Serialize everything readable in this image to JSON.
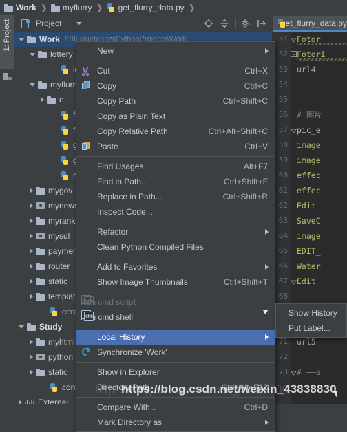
{
  "breadcrumb": {
    "items": [
      {
        "label": "Work",
        "icon": "folder-icon",
        "bold": true
      },
      {
        "label": "myflurry",
        "icon": "folder-icon",
        "bold": false
      },
      {
        "label": "get_flurry_data.py",
        "icon": "python-file-icon",
        "bold": false
      }
    ],
    "separator": "❯"
  },
  "left_tool_tab": {
    "label": "1: Project"
  },
  "project_toolbar": {
    "title": "Project",
    "icons": [
      {
        "name": "locate-icon"
      },
      {
        "name": "expand-collapse-icon"
      },
      {
        "name": "settings-gear-icon"
      },
      {
        "name": "hide-panel-icon"
      }
    ]
  },
  "editor_tabs": [
    {
      "label": "get_flurry_data.py",
      "icon": "python-file-icon",
      "active": true
    }
  ],
  "tree": {
    "root_path": "E:\\liuxuefengzi\\PythonProjects\\Work",
    "items": [
      {
        "label": "Work",
        "depth": 0,
        "twisty": "down",
        "icon": "folder-icon",
        "bold": true,
        "selected": true,
        "path": "E:\\liuxuefengzi\\PythonProjects\\Work"
      },
      {
        "label": "lottery",
        "depth": 1,
        "twisty": "down",
        "icon": "folder-icon",
        "bold": false,
        "selected": false
      },
      {
        "label": "lo",
        "depth": 3,
        "twisty": "none",
        "icon": "python-file-icon",
        "bold": false,
        "selected": false
      },
      {
        "label": "myflurry",
        "depth": 1,
        "twisty": "down",
        "icon": "folder-icon",
        "bold": false,
        "selected": false
      },
      {
        "label": "e",
        "depth": 2,
        "twisty": "right",
        "icon": "folder-icon",
        "bold": false,
        "selected": false
      },
      {
        "label": "f",
        "depth": 3,
        "twisty": "none",
        "icon": "python-file-icon",
        "bold": false,
        "selected": false
      },
      {
        "label": "f",
        "depth": 3,
        "twisty": "none",
        "icon": "python-file-icon",
        "bold": false,
        "selected": false
      },
      {
        "label": "g",
        "depth": 3,
        "twisty": "none",
        "icon": "python-file-icon",
        "bold": false,
        "selected": false
      },
      {
        "label": "g",
        "depth": 3,
        "twisty": "none",
        "icon": "python-file-icon",
        "bold": false,
        "selected": false
      },
      {
        "label": "r",
        "depth": 3,
        "twisty": "none",
        "icon": "python-file-icon",
        "bold": false,
        "selected": false
      },
      {
        "label": "mygov",
        "depth": 1,
        "twisty": "right",
        "icon": "folder-icon",
        "bold": false,
        "selected": false
      },
      {
        "label": "mynews",
        "depth": 1,
        "twisty": "right",
        "icon": "module-folder-icon",
        "bold": false,
        "selected": false
      },
      {
        "label": "myrank",
        "depth": 1,
        "twisty": "right",
        "icon": "folder-icon",
        "bold": false,
        "selected": false
      },
      {
        "label": "mysql",
        "depth": 1,
        "twisty": "right",
        "icon": "module-folder-icon",
        "bold": false,
        "selected": false
      },
      {
        "label": "payment",
        "depth": 1,
        "twisty": "right",
        "icon": "folder-icon",
        "bold": false,
        "selected": false
      },
      {
        "label": "router",
        "depth": 1,
        "twisty": "right",
        "icon": "folder-icon",
        "bold": false,
        "selected": false
      },
      {
        "label": "static",
        "depth": 1,
        "twisty": "right",
        "icon": "folder-icon",
        "bold": false,
        "selected": false
      },
      {
        "label": "templates",
        "depth": 1,
        "twisty": "right",
        "icon": "folder-icon",
        "bold": false,
        "selected": false
      },
      {
        "label": "config",
        "depth": 2,
        "twisty": "none",
        "icon": "python-file-icon",
        "bold": false,
        "selected": false
      },
      {
        "label": "Study",
        "depth": 0,
        "twisty": "down",
        "icon": "folder-icon",
        "bold": true,
        "selected": false
      },
      {
        "label": "myhtml",
        "depth": 1,
        "twisty": "right",
        "icon": "folder-icon",
        "bold": false,
        "selected": false
      },
      {
        "label": "python",
        "depth": 1,
        "twisty": "right",
        "icon": "module-folder-icon",
        "bold": false,
        "selected": false
      },
      {
        "label": "static",
        "depth": 1,
        "twisty": "right",
        "icon": "folder-icon",
        "bold": false,
        "selected": false
      },
      {
        "label": "config",
        "depth": 2,
        "twisty": "none",
        "icon": "python-file-icon",
        "bold": false,
        "selected": false
      },
      {
        "label": "External",
        "depth": 0,
        "twisty": "right",
        "icon": "library-icon",
        "bold": false,
        "selected": false
      }
    ]
  },
  "editor": {
    "first_line": 51,
    "lines": [
      {
        "n": 51,
        "text": "Fotor",
        "cls": "id",
        "fold": "collapse-plain",
        "squiggle": true
      },
      {
        "n": 52,
        "text": "FotorI",
        "cls": "id",
        "fold": "collapse-box",
        "squiggle": true
      },
      {
        "n": 53,
        "text": "url4 ",
        "cls": "va",
        "fold": "",
        "squiggle": false
      },
      {
        "n": 54,
        "text": "",
        "cls": "va",
        "fold": "",
        "squiggle": false
      },
      {
        "n": 55,
        "text": "",
        "cls": "va",
        "fold": "",
        "squiggle": false
      },
      {
        "n": 56,
        "text": "#  图片",
        "cls": "cm",
        "fold": "",
        "squiggle": false
      },
      {
        "n": 57,
        "text": "pic_e",
        "cls": "kw",
        "fold": "collapse-tri",
        "squiggle": false
      },
      {
        "n": 58,
        "text": "image",
        "cls": "id",
        "fold": "",
        "squiggle": false
      },
      {
        "n": 59,
        "text": "image",
        "cls": "id",
        "fold": "",
        "squiggle": false
      },
      {
        "n": 60,
        "text": "effec",
        "cls": "id",
        "fold": "",
        "squiggle": false
      },
      {
        "n": 61,
        "text": "effec",
        "cls": "id",
        "fold": "",
        "squiggle": false
      },
      {
        "n": 62,
        "text": "Edit",
        "cls": "id",
        "fold": "",
        "squiggle": false
      },
      {
        "n": 63,
        "text": "SaveC",
        "cls": "id",
        "fold": "",
        "squiggle": false
      },
      {
        "n": 64,
        "text": "image",
        "cls": "id",
        "fold": "",
        "squiggle": false
      },
      {
        "n": 65,
        "text": "EDIT_",
        "cls": "id",
        "fold": "",
        "squiggle": false
      },
      {
        "n": 66,
        "text": "Water",
        "cls": "id",
        "fold": "",
        "squiggle": false
      },
      {
        "n": 67,
        "text": "Edit",
        "cls": "id",
        "fold": "collapse-plain",
        "squiggle": false
      },
      {
        "n": 68,
        "text": "",
        "cls": "id",
        "fold": "",
        "squiggle": false
      },
      {
        "n": 69,
        "text": "",
        "cls": "id",
        "fold": "",
        "squiggle": false
      },
      {
        "n": 70,
        "text": "",
        "cls": "va",
        "fold": "",
        "squiggle": false
      },
      {
        "n": 71,
        "text": "url5 ",
        "cls": "va",
        "fold": "",
        "squiggle": false
      },
      {
        "n": 72,
        "text": "",
        "cls": "va",
        "fold": "",
        "squiggle": false
      },
      {
        "n": 73,
        "text": "#  ——a",
        "cls": "cm",
        "fold": "collapse-tri",
        "squiggle": false
      }
    ]
  },
  "context_menu": {
    "items": [
      {
        "type": "item",
        "label": "New",
        "shortcut": "",
        "icon": "",
        "submenu": true,
        "disabled": false,
        "highlighted": false
      },
      {
        "type": "separator"
      },
      {
        "type": "item",
        "label": "Cut",
        "shortcut": "Ctrl+X",
        "icon": "cut-icon",
        "submenu": false,
        "disabled": false,
        "highlighted": false
      },
      {
        "type": "item",
        "label": "Copy",
        "shortcut": "Ctrl+C",
        "icon": "copy-icon",
        "submenu": false,
        "disabled": false,
        "highlighted": false
      },
      {
        "type": "item",
        "label": "Copy Path",
        "shortcut": "Ctrl+Shift+C",
        "icon": "",
        "submenu": false,
        "disabled": false,
        "highlighted": false
      },
      {
        "type": "item",
        "label": "Copy as Plain Text",
        "shortcut": "",
        "icon": "",
        "submenu": false,
        "disabled": false,
        "highlighted": false
      },
      {
        "type": "item",
        "label": "Copy Relative Path",
        "shortcut": "Ctrl+Alt+Shift+C",
        "icon": "",
        "submenu": false,
        "disabled": false,
        "highlighted": false
      },
      {
        "type": "item",
        "label": "Paste",
        "shortcut": "Ctrl+V",
        "icon": "paste-icon",
        "submenu": false,
        "disabled": false,
        "highlighted": false
      },
      {
        "type": "separator"
      },
      {
        "type": "item",
        "label": "Find Usages",
        "shortcut": "Alt+F7",
        "icon": "",
        "submenu": false,
        "disabled": false,
        "highlighted": false
      },
      {
        "type": "item",
        "label": "Find in Path...",
        "shortcut": "Ctrl+Shift+F",
        "icon": "",
        "submenu": false,
        "disabled": false,
        "highlighted": false
      },
      {
        "type": "item",
        "label": "Replace in Path...",
        "shortcut": "Ctrl+Shift+R",
        "icon": "",
        "submenu": false,
        "disabled": false,
        "highlighted": false
      },
      {
        "type": "item",
        "label": "Inspect Code...",
        "shortcut": "",
        "icon": "",
        "submenu": false,
        "disabled": false,
        "highlighted": false
      },
      {
        "type": "separator"
      },
      {
        "type": "item",
        "label": "Refactor",
        "shortcut": "",
        "icon": "",
        "submenu": true,
        "disabled": false,
        "highlighted": false
      },
      {
        "type": "item",
        "label": "Clean Python Compiled Files",
        "shortcut": "",
        "icon": "",
        "submenu": false,
        "disabled": false,
        "highlighted": false
      },
      {
        "type": "separator"
      },
      {
        "type": "item",
        "label": "Add to Favorites",
        "shortcut": "",
        "icon": "",
        "submenu": true,
        "disabled": false,
        "highlighted": false
      },
      {
        "type": "item",
        "label": "Show Image Thumbnails",
        "shortcut": "Ctrl+Shift+T",
        "icon": "",
        "submenu": false,
        "disabled": false,
        "highlighted": false
      },
      {
        "type": "separator"
      },
      {
        "type": "item",
        "label": "Run cmd script",
        "shortcut": "",
        "icon": "cmd-icon",
        "submenu": false,
        "disabled": true,
        "highlighted": false
      },
      {
        "type": "item",
        "label": "Run cmd shell",
        "shortcut": "",
        "icon": "cmd-icon",
        "submenu": false,
        "disabled": false,
        "highlighted": false
      },
      {
        "type": "separator"
      },
      {
        "type": "item",
        "label": "Local History",
        "shortcut": "",
        "icon": "",
        "submenu": true,
        "disabled": false,
        "highlighted": true
      },
      {
        "type": "item",
        "label": "Synchronize 'Work'",
        "shortcut": "",
        "icon": "sync-icon",
        "submenu": false,
        "disabled": false,
        "highlighted": false
      },
      {
        "type": "separator"
      },
      {
        "type": "item",
        "label": "Show in Explorer",
        "shortcut": "",
        "icon": "",
        "submenu": false,
        "disabled": false,
        "highlighted": false
      },
      {
        "type": "item",
        "label": "Directory Path",
        "shortcut": "Ctrl+Alt+F12",
        "icon": "",
        "submenu": false,
        "disabled": false,
        "highlighted": false
      },
      {
        "type": "separator"
      },
      {
        "type": "item",
        "label": "Compare With...",
        "shortcut": "Ctrl+D",
        "icon": "compare-icon",
        "submenu": false,
        "disabled": false,
        "highlighted": false
      },
      {
        "type": "item",
        "label": "Mark Directory as",
        "shortcut": "",
        "icon": "",
        "submenu": true,
        "disabled": false,
        "highlighted": false
      }
    ]
  },
  "submenu": {
    "items": [
      {
        "label": "Show History"
      },
      {
        "label": "Put Label..."
      }
    ]
  },
  "watermark": {
    "text": "https://blog.csdn.net/weixin_43838830"
  },
  "colors": {
    "accent": "#4b6eaf",
    "tab_underline": "#4a88c7",
    "panel_bg": "#3c3f41",
    "editor_bg": "#2b2b2b",
    "selection": "#2b4a71",
    "code_identifier": "#b5bd68",
    "code_comment": "#808080"
  }
}
